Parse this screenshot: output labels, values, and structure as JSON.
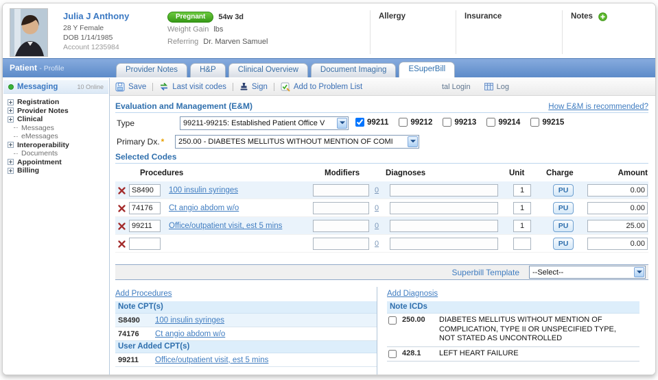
{
  "window": {
    "title": "Patient",
    "subtitle": "- Profile"
  },
  "patient": {
    "name": "Julia J Anthony",
    "age_sex": "28 Y Female",
    "dob": "DOB 1/14/1985",
    "account": "Account 1235984",
    "status_badge": "Pregnant",
    "gestation": "54w 3d",
    "weight_gain_label": "Weight Gain",
    "weight_gain_unit": "lbs",
    "referring_label": "Referring",
    "referring": "Dr. Marven Samuel"
  },
  "header_cols": {
    "allergy": "Allergy",
    "insurance": "Insurance",
    "notes": "Notes"
  },
  "tabs": [
    {
      "label": "Provider Notes"
    },
    {
      "label": "H&P"
    },
    {
      "label": "Clinical Overview"
    },
    {
      "label": "Document Imaging"
    },
    {
      "label": "ESuperBill"
    }
  ],
  "sidebar": {
    "messaging_label": "Messaging",
    "messaging_status": "10 Online",
    "items": [
      {
        "label": "Registration"
      },
      {
        "label": "Provider Notes"
      },
      {
        "label": "Clinical"
      },
      {
        "label": "Messages"
      },
      {
        "label": "eMessages"
      },
      {
        "label": "Interoperability"
      },
      {
        "label": "Documents"
      },
      {
        "label": "Appointment"
      },
      {
        "label": "Billing"
      }
    ]
  },
  "toolbar": {
    "save": "Save",
    "last_visit_codes": "Last visit codes",
    "sign": "Sign",
    "add_to_problem_list": "Add to Problem List",
    "portal_login": "tal Login",
    "log": "Log"
  },
  "em": {
    "title": "Evaluation and Management (E&M)",
    "help_link": "How E&M is recommended?",
    "type_label": "Type",
    "type_value": "99211-99215: Established Patient Office V",
    "required_mark": "*",
    "codes": [
      {
        "label": "99211",
        "checked": "checked"
      },
      {
        "label": "99212"
      },
      {
        "label": "99213"
      },
      {
        "label": "99214"
      },
      {
        "label": "99215"
      }
    ],
    "primary_dx_label": "Primary Dx.",
    "primary_dx_value": "250.00 - DIABETES MELLITUS WITHOUT MENTION OF COMI"
  },
  "selected_codes": {
    "title": "Selected Codes",
    "headers": {
      "procedures": "Procedures",
      "modifiers": "Modifiers",
      "diagnoses": "Diagnoses",
      "unit": "Unit",
      "charge": "Charge",
      "amount": "Amount"
    },
    "rows": [
      {
        "code": "S8490",
        "desc": "100 insulin syringes",
        "modifier": "",
        "mod_count": "0",
        "diagnosis": "",
        "unit": "1",
        "charge": "PU",
        "amount": "0.00"
      },
      {
        "code": "74176",
        "desc": "Ct angio abdom w/o",
        "modifier": "",
        "mod_count": "0",
        "diagnosis": "",
        "unit": "1",
        "charge": "PU",
        "amount": "0.00"
      },
      {
        "code": "99211",
        "desc": "Office/outpatient visit, est 5 mins",
        "modifier": "",
        "mod_count": "0",
        "diagnosis": "",
        "unit": "1",
        "charge": "PU",
        "amount": "25.00"
      },
      {
        "code": "",
        "desc": "",
        "modifier": "",
        "mod_count": "0",
        "diagnosis": "",
        "unit": "",
        "charge": "PU",
        "amount": "0.00"
      }
    ]
  },
  "superbill": {
    "label": "Superbill Template",
    "value": "--Select--"
  },
  "procedures": {
    "add_link": "Add Procedures",
    "note_title": "Note CPT(s)",
    "note_rows": [
      {
        "code": "S8490",
        "desc": "100 insulin syringes"
      },
      {
        "code": "74176",
        "desc": "Ct angio abdom w/o"
      }
    ],
    "user_title": "User Added CPT(s)",
    "user_rows": [
      {
        "code": "99211",
        "desc": "Office/outpatient visit, est 5 mins"
      }
    ]
  },
  "diagnoses": {
    "add_link": "Add Diagnosis",
    "note_title": "Note ICDs",
    "rows": [
      {
        "code": "250.00",
        "desc": "DIABETES MELLITUS WITHOUT MENTION OF COMPLICATION, TYPE II OR UNSPECIFIED TYPE, NOT STATED AS UNCONTROLLED"
      },
      {
        "code": "428.1",
        "desc": "LEFT HEART FAILURE"
      }
    ]
  },
  "colors": {
    "titlebar_blue": "#5c8bc9",
    "link_blue": "#3f7cc0",
    "section_blue": "#2f6fad",
    "row_highlight": "#eaf3fb",
    "band_blue": "#ddeefb",
    "badge_green": "#4caf2a",
    "delete_red": "#a32b2b"
  }
}
